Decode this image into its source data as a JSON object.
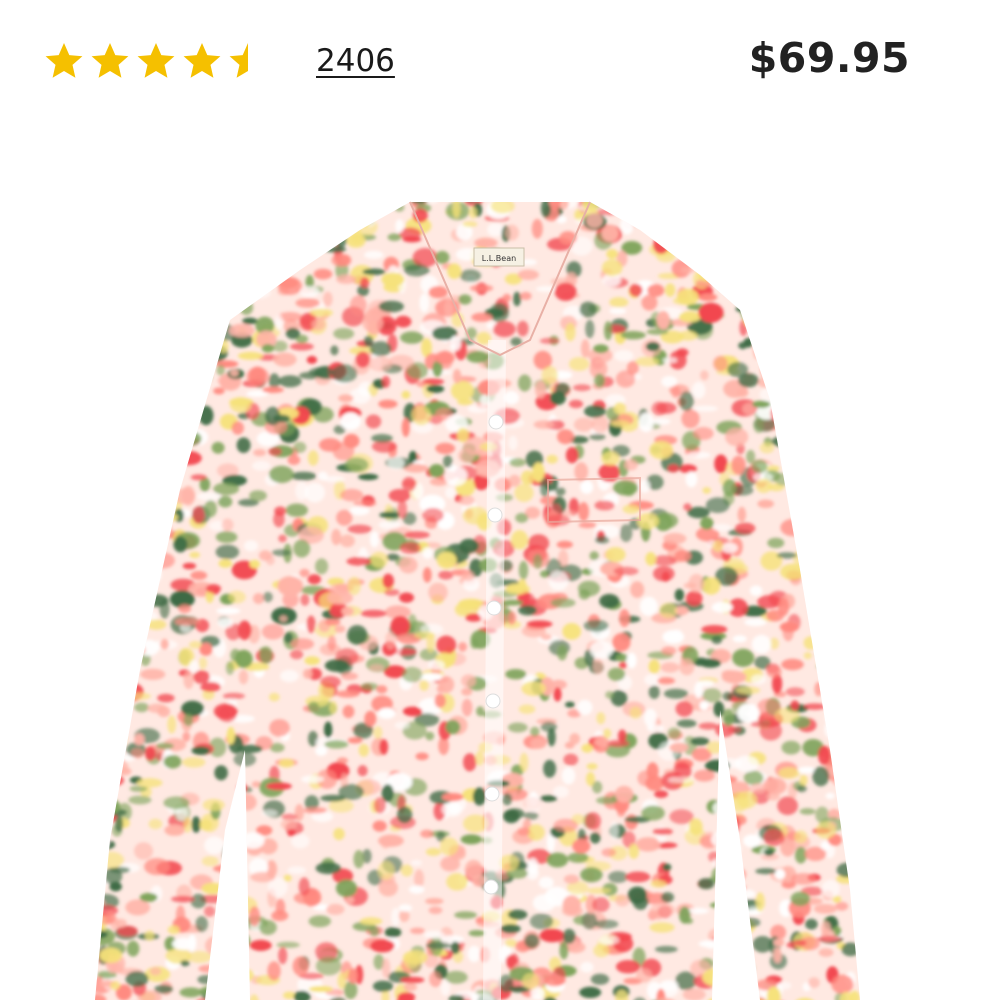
{
  "rating": {
    "value": 4.5,
    "max": 5,
    "star_color": "#F5C000",
    "review_count": "2406"
  },
  "price": "$69.95",
  "product": {
    "brand_tag": "L.L.Bean",
    "print_colors": [
      "#F2474F",
      "#FF8A80",
      "#FFB3A7",
      "#3E6B45",
      "#7DA35A",
      "#F6E27A",
      "#FFFFFF"
    ]
  }
}
